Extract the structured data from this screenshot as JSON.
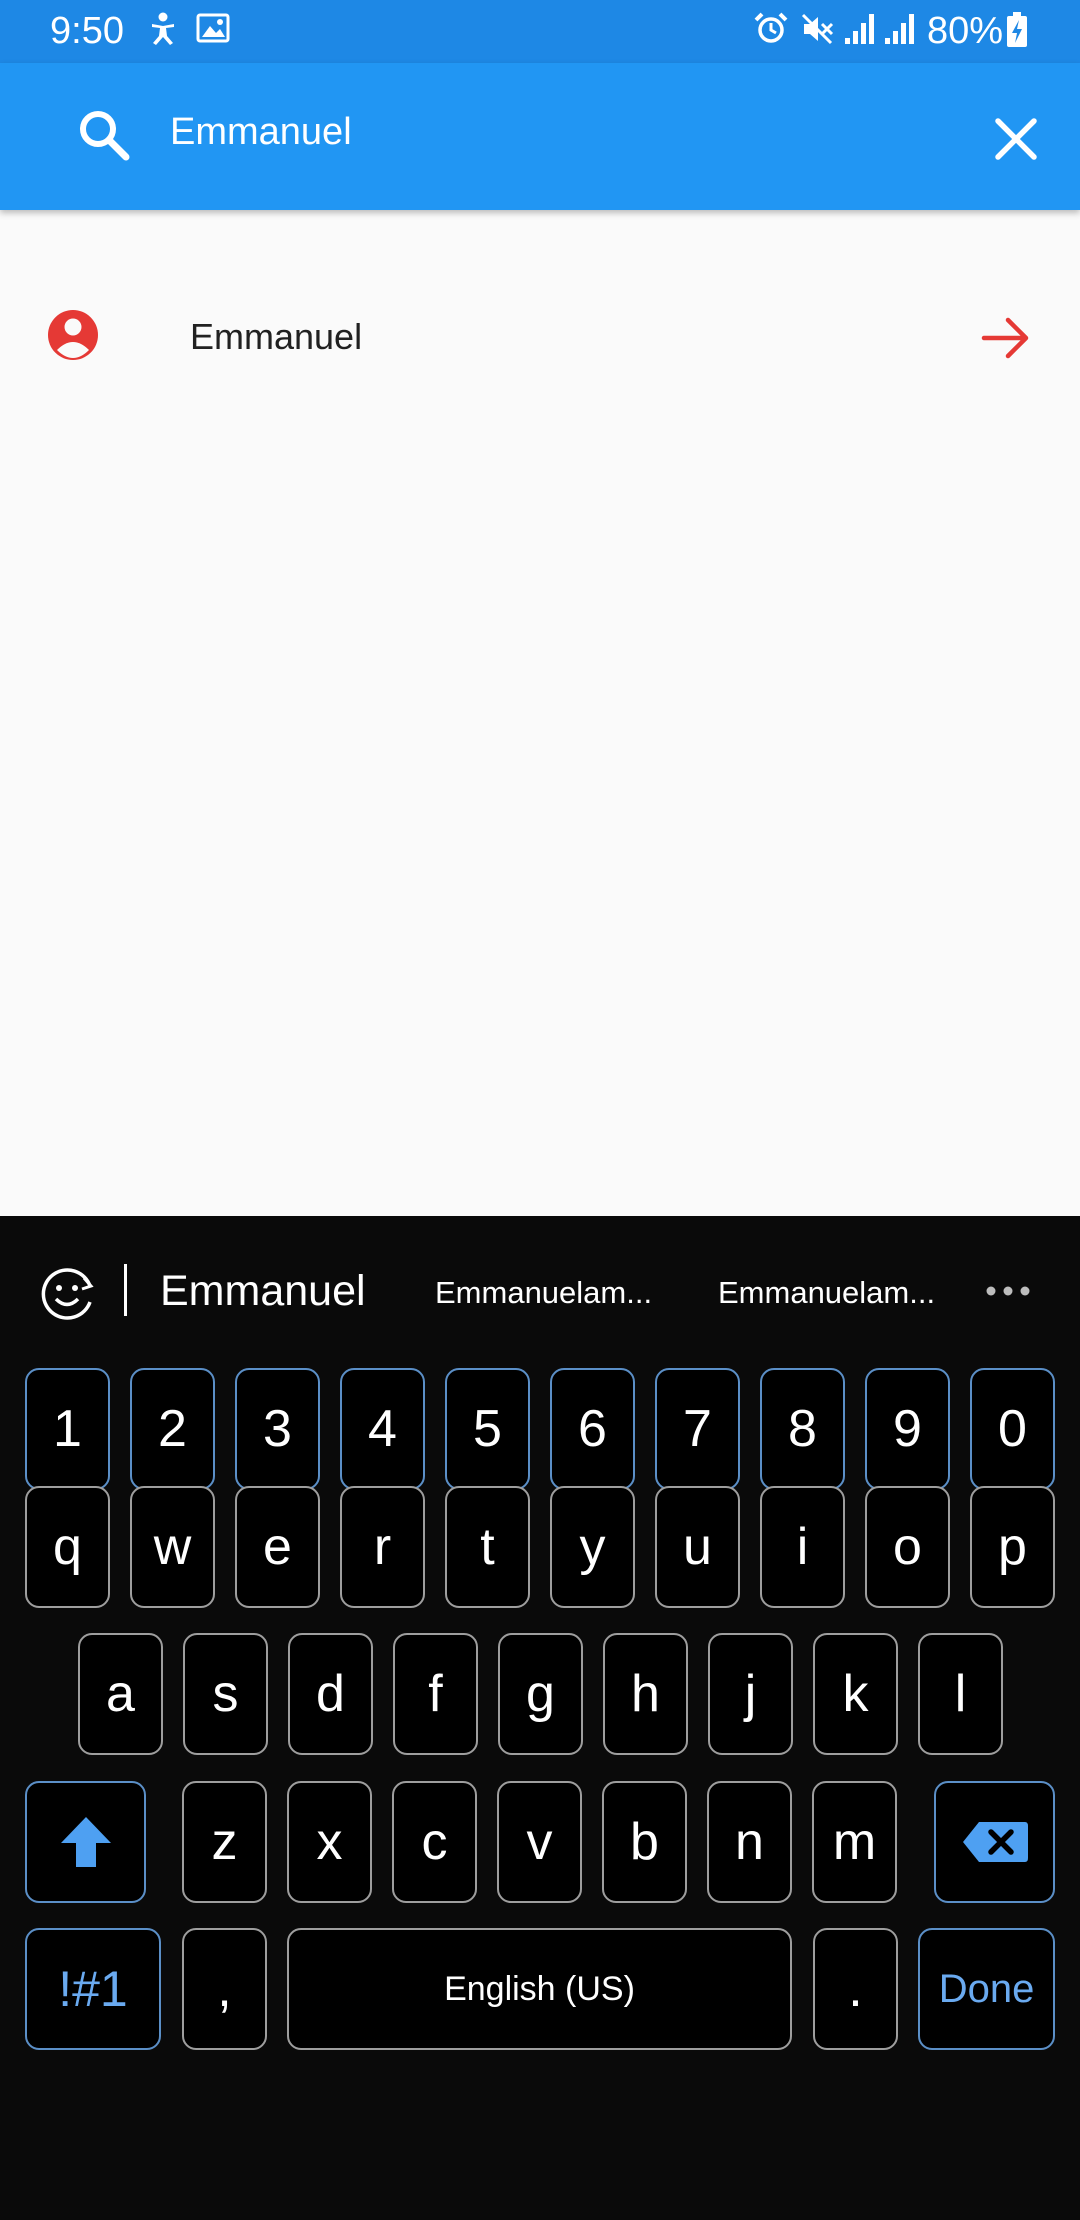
{
  "status_bar": {
    "time": "9:50",
    "battery": "80%",
    "icons": [
      "accessibility-icon",
      "image-icon",
      "alarm-icon",
      "mute-icon",
      "signal-icon",
      "signal-icon",
      "battery-icon"
    ]
  },
  "search": {
    "value": "Emmanuel",
    "icon": "search-icon",
    "clear_icon": "close-icon"
  },
  "results": [
    {
      "label": "Emmanuel",
      "icon": "person-icon",
      "action_icon": "arrow-right-icon"
    }
  ],
  "keyboard": {
    "suggestions": [
      "Emmanuel",
      "Emmanuelam...",
      "Emmanuelam..."
    ],
    "rows": [
      [
        "1",
        "2",
        "3",
        "4",
        "5",
        "6",
        "7",
        "8",
        "9",
        "0"
      ],
      [
        "q",
        "w",
        "e",
        "r",
        "t",
        "y",
        "u",
        "i",
        "o",
        "p"
      ],
      [
        "a",
        "s",
        "d",
        "f",
        "g",
        "h",
        "j",
        "k",
        "l"
      ],
      [
        "z",
        "x",
        "c",
        "v",
        "b",
        "n",
        "m"
      ]
    ],
    "symbols_key": "!#1",
    "comma_key": ",",
    "space_label": "English (US)",
    "period_key": ".",
    "done_label": "Done"
  },
  "colors": {
    "app_bar": "#2196f3",
    "status_bar": "#1e88e5",
    "accent_red": "#e53935",
    "keyboard_bg": "#0a0a0a",
    "keyboard_blue": "#6aaaf0"
  }
}
